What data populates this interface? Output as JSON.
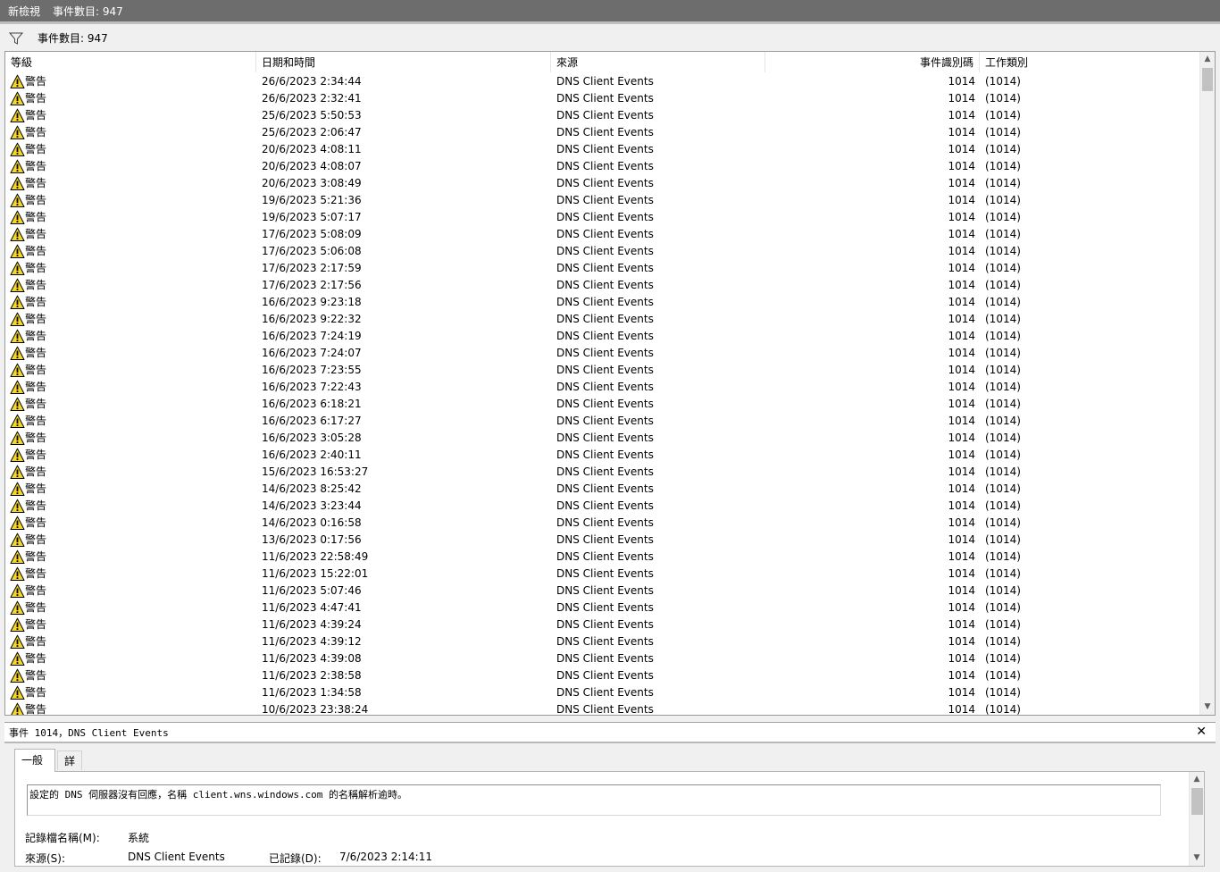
{
  "window": {
    "title": "新檢視",
    "event_count": "事件數目: 947"
  },
  "filterbar": {
    "text": "事件數目: 947"
  },
  "columns": {
    "level": "等級",
    "datetime": "日期和時間",
    "source": "來源",
    "event_id": "事件識別碼",
    "task_category": "工作類別"
  },
  "rows": [
    {
      "level": "警告",
      "datetime": "26/6/2023 2:34:44",
      "source": "DNS Client Events",
      "event_id": "1014",
      "category": "(1014)"
    },
    {
      "level": "警告",
      "datetime": "26/6/2023 2:32:41",
      "source": "DNS Client Events",
      "event_id": "1014",
      "category": "(1014)"
    },
    {
      "level": "警告",
      "datetime": "25/6/2023 5:50:53",
      "source": "DNS Client Events",
      "event_id": "1014",
      "category": "(1014)"
    },
    {
      "level": "警告",
      "datetime": "25/6/2023 2:06:47",
      "source": "DNS Client Events",
      "event_id": "1014",
      "category": "(1014)"
    },
    {
      "level": "警告",
      "datetime": "20/6/2023 4:08:11",
      "source": "DNS Client Events",
      "event_id": "1014",
      "category": "(1014)"
    },
    {
      "level": "警告",
      "datetime": "20/6/2023 4:08:07",
      "source": "DNS Client Events",
      "event_id": "1014",
      "category": "(1014)"
    },
    {
      "level": "警告",
      "datetime": "20/6/2023 3:08:49",
      "source": "DNS Client Events",
      "event_id": "1014",
      "category": "(1014)"
    },
    {
      "level": "警告",
      "datetime": "19/6/2023 5:21:36",
      "source": "DNS Client Events",
      "event_id": "1014",
      "category": "(1014)"
    },
    {
      "level": "警告",
      "datetime": "19/6/2023 5:07:17",
      "source": "DNS Client Events",
      "event_id": "1014",
      "category": "(1014)"
    },
    {
      "level": "警告",
      "datetime": "17/6/2023 5:08:09",
      "source": "DNS Client Events",
      "event_id": "1014",
      "category": "(1014)"
    },
    {
      "level": "警告",
      "datetime": "17/6/2023 5:06:08",
      "source": "DNS Client Events",
      "event_id": "1014",
      "category": "(1014)"
    },
    {
      "level": "警告",
      "datetime": "17/6/2023 2:17:59",
      "source": "DNS Client Events",
      "event_id": "1014",
      "category": "(1014)"
    },
    {
      "level": "警告",
      "datetime": "17/6/2023 2:17:56",
      "source": "DNS Client Events",
      "event_id": "1014",
      "category": "(1014)"
    },
    {
      "level": "警告",
      "datetime": "16/6/2023 9:23:18",
      "source": "DNS Client Events",
      "event_id": "1014",
      "category": "(1014)"
    },
    {
      "level": "警告",
      "datetime": "16/6/2023 9:22:32",
      "source": "DNS Client Events",
      "event_id": "1014",
      "category": "(1014)"
    },
    {
      "level": "警告",
      "datetime": "16/6/2023 7:24:19",
      "source": "DNS Client Events",
      "event_id": "1014",
      "category": "(1014)"
    },
    {
      "level": "警告",
      "datetime": "16/6/2023 7:24:07",
      "source": "DNS Client Events",
      "event_id": "1014",
      "category": "(1014)"
    },
    {
      "level": "警告",
      "datetime": "16/6/2023 7:23:55",
      "source": "DNS Client Events",
      "event_id": "1014",
      "category": "(1014)"
    },
    {
      "level": "警告",
      "datetime": "16/6/2023 7:22:43",
      "source": "DNS Client Events",
      "event_id": "1014",
      "category": "(1014)"
    },
    {
      "level": "警告",
      "datetime": "16/6/2023 6:18:21",
      "source": "DNS Client Events",
      "event_id": "1014",
      "category": "(1014)"
    },
    {
      "level": "警告",
      "datetime": "16/6/2023 6:17:27",
      "source": "DNS Client Events",
      "event_id": "1014",
      "category": "(1014)"
    },
    {
      "level": "警告",
      "datetime": "16/6/2023 3:05:28",
      "source": "DNS Client Events",
      "event_id": "1014",
      "category": "(1014)"
    },
    {
      "level": "警告",
      "datetime": "16/6/2023 2:40:11",
      "source": "DNS Client Events",
      "event_id": "1014",
      "category": "(1014)"
    },
    {
      "level": "警告",
      "datetime": "15/6/2023 16:53:27",
      "source": "DNS Client Events",
      "event_id": "1014",
      "category": "(1014)"
    },
    {
      "level": "警告",
      "datetime": "14/6/2023 8:25:42",
      "source": "DNS Client Events",
      "event_id": "1014",
      "category": "(1014)"
    },
    {
      "level": "警告",
      "datetime": "14/6/2023 3:23:44",
      "source": "DNS Client Events",
      "event_id": "1014",
      "category": "(1014)"
    },
    {
      "level": "警告",
      "datetime": "14/6/2023 0:16:58",
      "source": "DNS Client Events",
      "event_id": "1014",
      "category": "(1014)"
    },
    {
      "level": "警告",
      "datetime": "13/6/2023 0:17:56",
      "source": "DNS Client Events",
      "event_id": "1014",
      "category": "(1014)"
    },
    {
      "level": "警告",
      "datetime": "11/6/2023 22:58:49",
      "source": "DNS Client Events",
      "event_id": "1014",
      "category": "(1014)"
    },
    {
      "level": "警告",
      "datetime": "11/6/2023 15:22:01",
      "source": "DNS Client Events",
      "event_id": "1014",
      "category": "(1014)"
    },
    {
      "level": "警告",
      "datetime": "11/6/2023 5:07:46",
      "source": "DNS Client Events",
      "event_id": "1014",
      "category": "(1014)"
    },
    {
      "level": "警告",
      "datetime": "11/6/2023 4:47:41",
      "source": "DNS Client Events",
      "event_id": "1014",
      "category": "(1014)"
    },
    {
      "level": "警告",
      "datetime": "11/6/2023 4:39:24",
      "source": "DNS Client Events",
      "event_id": "1014",
      "category": "(1014)"
    },
    {
      "level": "警告",
      "datetime": "11/6/2023 4:39:12",
      "source": "DNS Client Events",
      "event_id": "1014",
      "category": "(1014)"
    },
    {
      "level": "警告",
      "datetime": "11/6/2023 4:39:08",
      "source": "DNS Client Events",
      "event_id": "1014",
      "category": "(1014)"
    },
    {
      "level": "警告",
      "datetime": "11/6/2023 2:38:58",
      "source": "DNS Client Events",
      "event_id": "1014",
      "category": "(1014)"
    },
    {
      "level": "警告",
      "datetime": "11/6/2023 1:34:58",
      "source": "DNS Client Events",
      "event_id": "1014",
      "category": "(1014)"
    },
    {
      "level": "警告",
      "datetime": "10/6/2023 23:38:24",
      "source": "DNS Client Events",
      "event_id": "1014",
      "category": "(1014)"
    }
  ],
  "detail": {
    "title": "事件 1014，DNS Client Events",
    "tabs": {
      "general": "一般",
      "details": "詳細資料"
    },
    "message": "設定的 DNS 伺服器沒有回應，名稱 client.wns.windows.com 的名稱解析逾時。",
    "log_name_label": "記錄檔名稱(M):",
    "log_name_value": "系統",
    "source_label": "來源(S):",
    "source_value": "DNS Client Events",
    "logged_label": "已記錄(D):",
    "logged_value": "7/6/2023 2:14:11"
  },
  "colors": {
    "titlebar": "#6d6d6d",
    "warning_fill": "#f6d629",
    "warning_stroke": "#000000"
  },
  "icons": {
    "filter": "filter-icon",
    "warning": "warning-icon",
    "close": "close-icon"
  }
}
